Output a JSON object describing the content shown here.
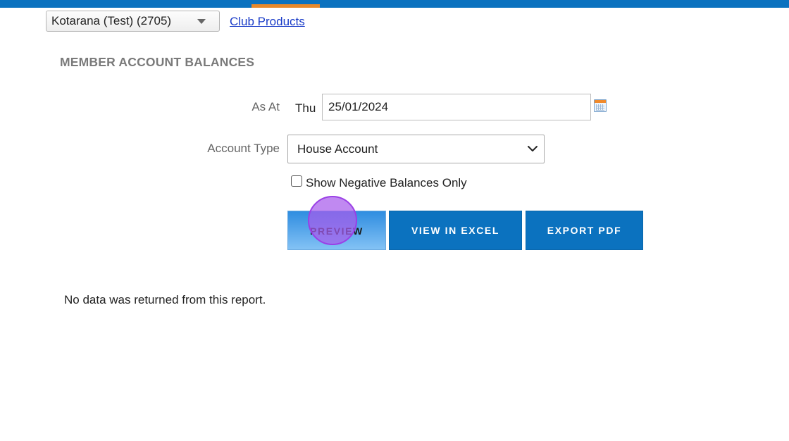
{
  "header": {
    "club_select_value": "Kotarana (Test) (2705)",
    "club_products_link": "Club Products"
  },
  "page": {
    "title": "MEMBER ACCOUNT BALANCES"
  },
  "form": {
    "as_at_label": "As At",
    "day": "Thu",
    "date_value": "25/01/2024",
    "account_type_label": "Account Type",
    "account_type_value": "House Account",
    "show_negative_label": "Show Negative Balances Only",
    "show_negative_checked": false
  },
  "buttons": {
    "preview": "PREVIEW",
    "view_excel": "VIEW IN EXCEL",
    "export_pdf": "EXPORT PDF"
  },
  "result": {
    "message": "No data was returned from this report."
  },
  "colors": {
    "brand_blue": "#0b72bf",
    "accent_orange": "#e8892a",
    "link_blue": "#1a3cc8",
    "cursor_highlight": "#a85ceb"
  },
  "icons": {
    "calendar": "calendar-icon",
    "select_caret": "caret-down-icon",
    "dropdown_chevron": "chevron-down-icon"
  }
}
